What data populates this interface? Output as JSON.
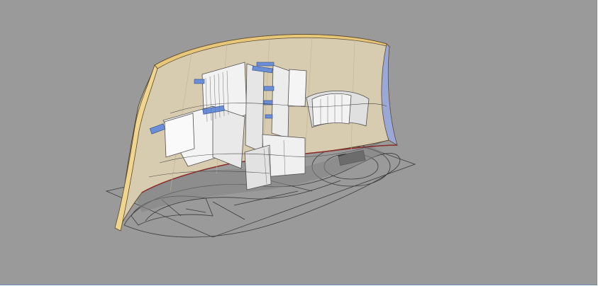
{
  "viewport": {
    "background": "#9a9a9a",
    "frame_color": "#6c8fb8"
  },
  "model": {
    "wall_fill": "#d8ccb0",
    "wall_edge": "#e8c878",
    "wall_outline": "#5a4a30",
    "plan_line": "#3c3c3c",
    "panel_fill": "#f4f4f4",
    "window_fill": "#6b8fd6",
    "shadow_fill": "#838383",
    "accent_edge": "#8a2b2b"
  }
}
